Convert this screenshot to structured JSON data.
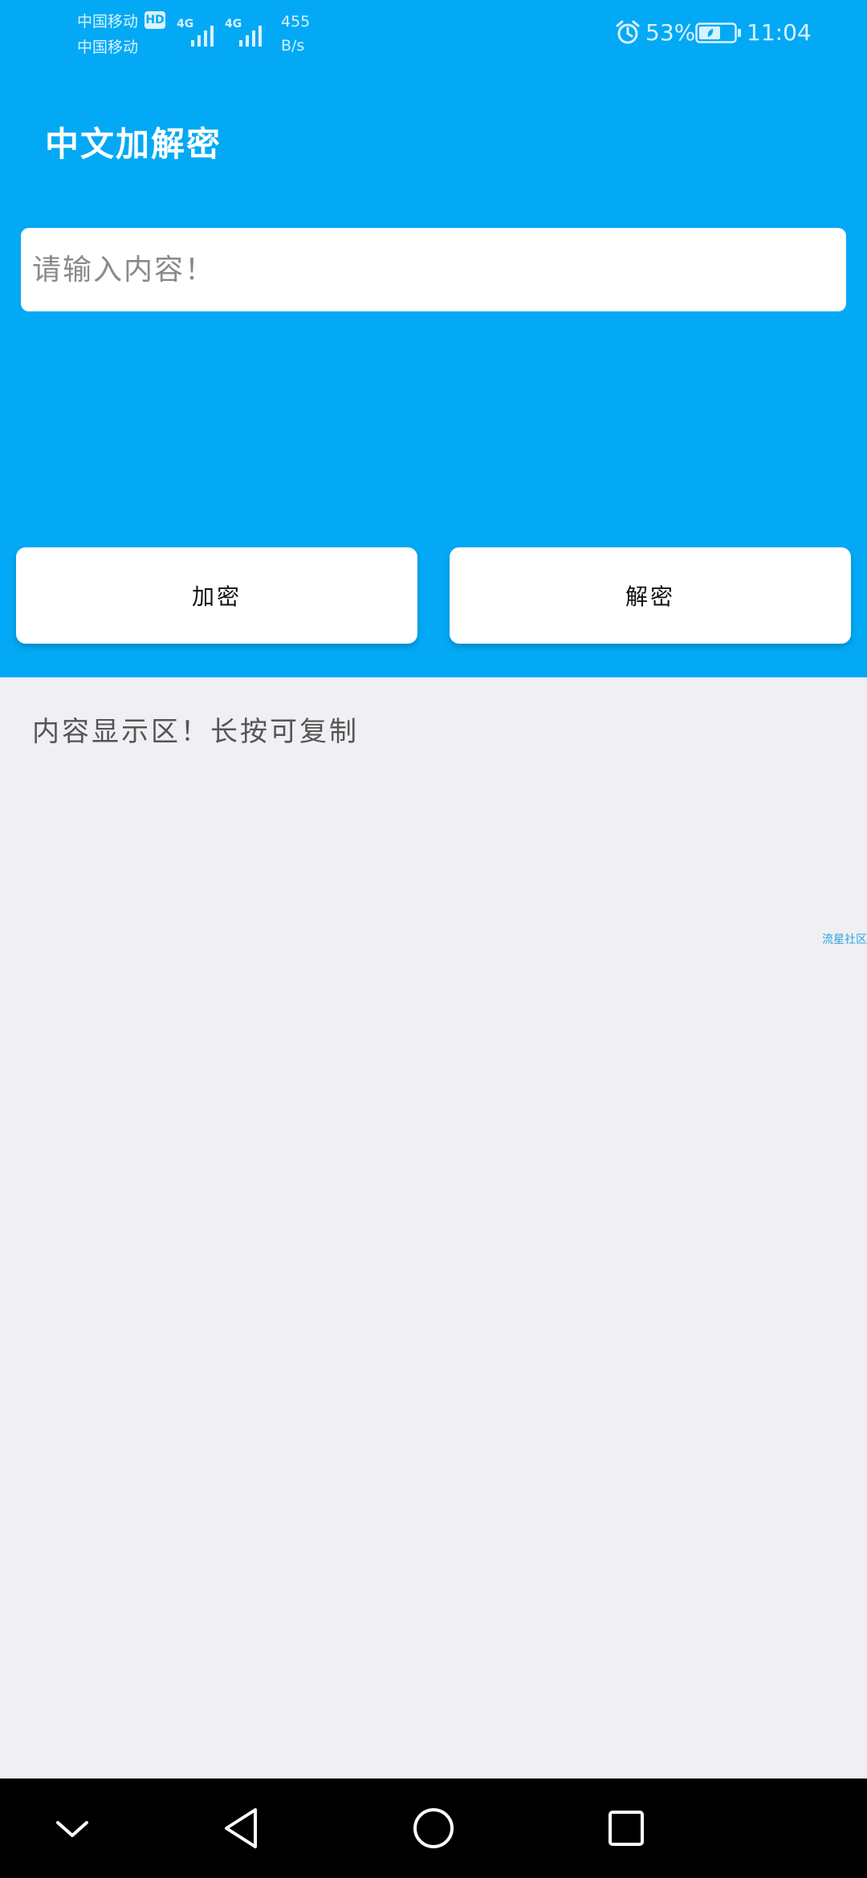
{
  "status_bar": {
    "carrier_1": "中国移动",
    "carrier_2": "中国移动",
    "hd_badge": "HD",
    "network_1": "4G",
    "network_2": "4G",
    "speed_value": "455",
    "speed_unit": "B/s",
    "battery_percent": "53%",
    "time": "11:04",
    "icons": [
      "alarm-icon",
      "battery-icon",
      "signal-icon"
    ]
  },
  "app_bar": {
    "title": "中文加解密"
  },
  "input": {
    "placeholder": "请输入内容！",
    "value": ""
  },
  "buttons": {
    "encrypt_label": "加密",
    "decrypt_label": "解密"
  },
  "result": {
    "text": "内容显示区！长按可复制"
  },
  "watermark": "流星社区",
  "nav_bar": {
    "icons": [
      "chevron-down-icon",
      "back-icon",
      "home-icon",
      "recent-apps-icon"
    ]
  },
  "colors": {
    "primary": "#03a9f4",
    "background": "#efeff4",
    "surface": "#ffffff",
    "nav": "#000000"
  }
}
